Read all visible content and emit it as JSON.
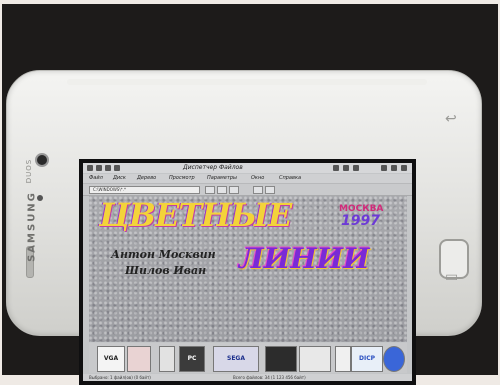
{
  "window": {
    "title": "Диспетчер Файлов",
    "menu": [
      "Файл",
      "Диск",
      "Дерево",
      "Просмотр",
      "Параметры",
      "Окно",
      "Справка"
    ],
    "path": "C:\\WINDOWS\\*.*"
  },
  "poster": {
    "title": "ЦВЕТНЫЕ",
    "subtitle": "ЛИНИИ",
    "city": "МОСКВА",
    "year": "1997",
    "author1": "Антон Москвин",
    "author2": "Шилов Иван"
  },
  "logos": [
    "VGA",
    "",
    "",
    "PC",
    "SEGA",
    "",
    "",
    "",
    "DICP",
    ""
  ],
  "statusbar": {
    "left": "Выбрано: 1 файл(ов) (0 байт)",
    "right": "Всего файлов: 34 (1 123 456 байт)"
  },
  "device": {
    "brand": "SAMSUNG",
    "model": "DUOS"
  }
}
